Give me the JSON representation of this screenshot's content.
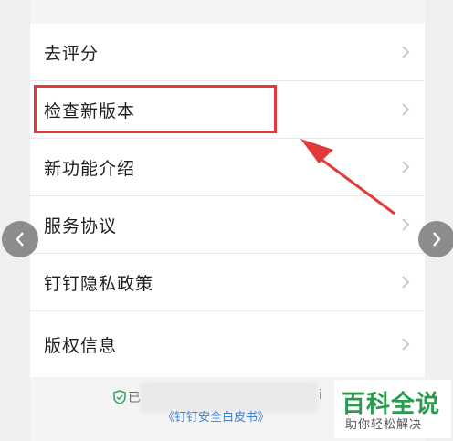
{
  "menu": {
    "items": [
      {
        "label": "去评分"
      },
      {
        "label": "检查新版本"
      },
      {
        "label": "新功能介绍"
      },
      {
        "label": "服务协议"
      },
      {
        "label": "钉钉隐私政策"
      },
      {
        "label": "版权信息"
      }
    ]
  },
  "footer": {
    "certified_prefix": "已",
    "certified_tail": "i",
    "whitepaper_link": "《钉钉安全白皮书》"
  },
  "watermark": {
    "brand": "百科全说",
    "slogan": "助你轻松解决"
  },
  "colors": {
    "highlight": "#e23a3a",
    "link": "#3f7fd8",
    "shield": "#2aa35a",
    "watermark": "#2a9a4c"
  },
  "icons": {
    "row_chevron": "chevron-right-icon",
    "prev": "chevron-left-icon",
    "next": "chevron-right-icon",
    "footer": "shield-check-icon"
  }
}
